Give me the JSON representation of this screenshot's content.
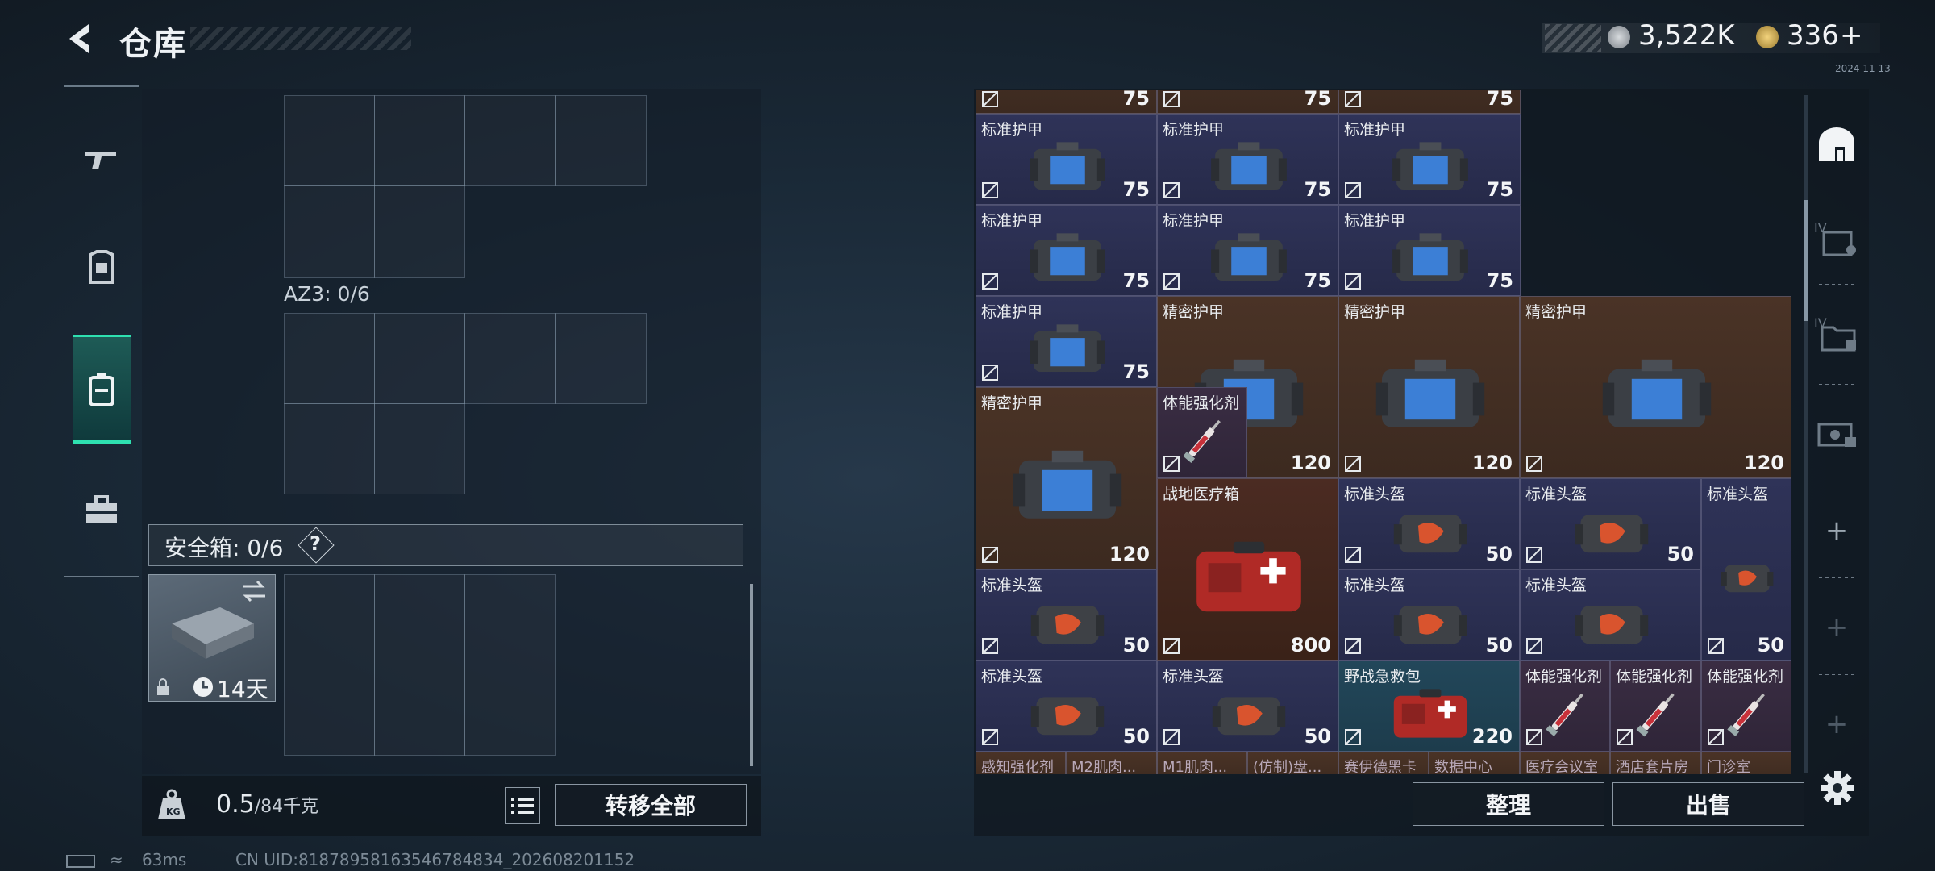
{
  "header": {
    "title": "仓库",
    "currency1": "3,522K",
    "currency2": "336",
    "plus": "+",
    "version": "2024 11 13"
  },
  "left_tabs": [
    "gun-tab",
    "armor-tab",
    "backpack-tab",
    "toolbox-tab"
  ],
  "az3_label": "AZ3: 0/6",
  "safe_box": {
    "label": "安全箱: 0/6",
    "help": "?"
  },
  "case_item": {
    "duration": "14天"
  },
  "weight": {
    "current": "0.5",
    "max": "/84千克"
  },
  "buttons": {
    "transfer_all": "转移全部",
    "sort": "整理",
    "sell": "出售"
  },
  "status": {
    "ping": "63ms",
    "uid": "CN UID:81878958163546784834_202608201152"
  },
  "storage": {
    "top_values": [
      "75",
      "75",
      "75"
    ],
    "rows": [
      [
        {
          "name": "标准护甲",
          "value": "75"
        },
        {
          "name": "标准护甲",
          "value": "75"
        },
        {
          "name": "标准护甲",
          "value": "75"
        }
      ],
      [
        {
          "name": "标准护甲",
          "value": "75"
        },
        {
          "name": "标准护甲",
          "value": "75"
        },
        {
          "name": "标准护甲",
          "value": "75"
        }
      ],
      [
        {
          "name": "标准护甲",
          "value": "75"
        },
        {
          "name": "精密护甲"
        },
        {
          "name": "精密护甲"
        },
        {
          "name": "精密护甲"
        }
      ],
      [
        {
          "name": "精密护甲",
          "value": "120"
        },
        {
          "name": "体能强化剂"
        },
        {
          "value": "120"
        },
        {
          "value": "120"
        },
        {
          "value": "120"
        }
      ],
      [
        {
          "name": "战地医疗箱",
          "value": "800"
        },
        {
          "name": "标准头盔",
          "value": "50"
        },
        {
          "name": "标准头盔",
          "value": "50"
        },
        {
          "name": "标准头盔",
          "value": "50"
        }
      ],
      [
        {
          "name": "标准头盔",
          "value": "50"
        },
        {
          "name": "标准头盔",
          "value": "50"
        },
        {
          "name": "标准头盔",
          "value": "50"
        }
      ],
      [
        {
          "name": "标准头盔",
          "value": "50"
        },
        {
          "name": "标准头盔",
          "value": "50"
        },
        {
          "name": "野战急救包",
          "value": "220"
        },
        {
          "name": "体能强化剂"
        },
        {
          "name": "体能强化剂"
        },
        {
          "name": "体能强化剂"
        }
      ]
    ],
    "bottom_labels": [
      "感知强化剂",
      "M2肌肉...",
      "M1肌肉...",
      "(仿制)盘...",
      "赛伊德黑卡",
      "数据中心",
      "医疗会议室",
      "酒店套片房",
      "门诊室"
    ]
  },
  "colors": {
    "accent": "#2ee0b0",
    "blue_cell": "#2f3358",
    "brown_cell": "#4a3326",
    "teal_cell": "#22475a"
  },
  "right_tabs": [
    "safehouse-icon",
    "armor-storage-icon",
    "folder-storage-icon",
    "camera-storage-icon",
    "plus-icon",
    "plus-icon",
    "plus-icon"
  ]
}
